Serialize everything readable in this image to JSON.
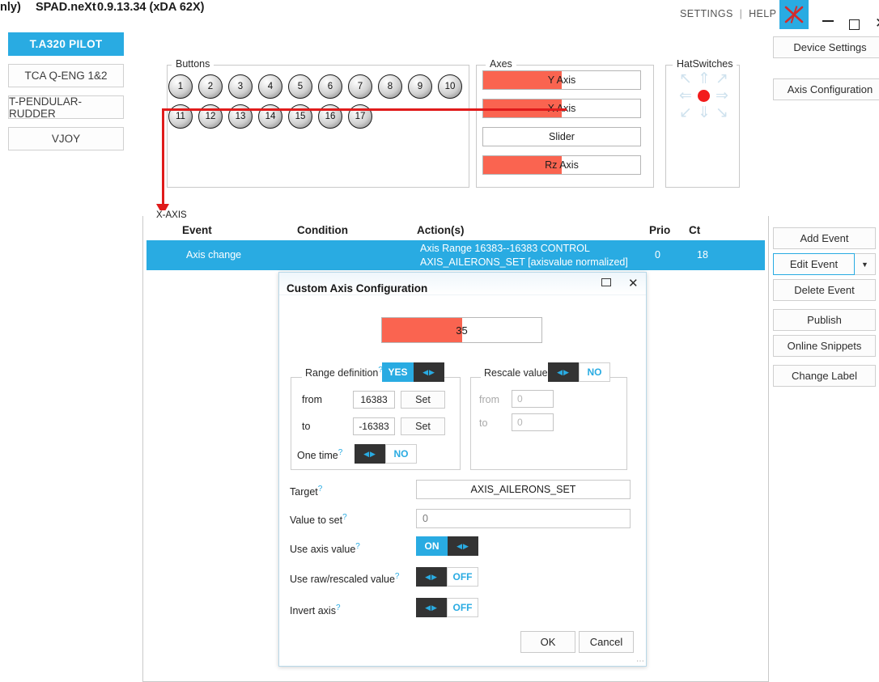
{
  "app": {
    "title_prefix": "nly)",
    "name": "SPAD.neXt",
    "version": "0.9.13.34 (xDA 62X)",
    "logo_icon": "red-plane-icon",
    "accent_color": "#29ABE2",
    "axis_fill_color": "#fa6450",
    "annotation_color": "#e01b1b"
  },
  "topmenu": {
    "settings": "SETTINGS",
    "separator": "|",
    "help": "HELP"
  },
  "window_controls": {
    "minimize": "minimize-icon",
    "maximize": "maximize-icon",
    "close": "close-icon"
  },
  "devices": [
    {
      "label": "T.A320 PILOT",
      "active": true
    },
    {
      "label": "TCA Q-ENG 1&2",
      "active": false
    },
    {
      "label": "T-PENDULAR-RUDDER",
      "active": false
    },
    {
      "label": "VJOY",
      "active": false
    }
  ],
  "right_panel": {
    "device_settings": "Device Settings",
    "axis_configuration": "Axis Configuration"
  },
  "buttons_group": {
    "label": "Buttons",
    "items": [
      "1",
      "2",
      "3",
      "4",
      "5",
      "6",
      "7",
      "8",
      "9",
      "10",
      "11",
      "12",
      "13",
      "14",
      "15",
      "16",
      "17"
    ]
  },
  "axes_group": {
    "label": "Axes",
    "items": [
      {
        "label": "Y Axis",
        "fill_percent": 50
      },
      {
        "label": "X Axis",
        "fill_percent": 50
      },
      {
        "label": "Slider",
        "fill_percent": 0
      },
      {
        "label": "Rz Axis",
        "fill_percent": 50
      }
    ]
  },
  "hat_group": {
    "label": "HatSwitches",
    "arrows": [
      "↖",
      "⇑",
      "↗",
      "⇐",
      "⇒",
      "↙",
      "⇓",
      "↘"
    ],
    "center_icon": "hat-center-dot"
  },
  "annotation": {
    "label": "X-AXIS"
  },
  "event_table": {
    "columns": [
      "Event",
      "Condition",
      "Action(s)",
      "Prio",
      "Ct"
    ],
    "rows": [
      {
        "event": "Axis change",
        "condition": "",
        "action_line1": "Axis Range 16383--16383 CONTROL",
        "action_line2": "AXIS_AILERONS_SET [axisvalue normalized]",
        "prio": "0",
        "ct": "18",
        "selected": true
      }
    ]
  },
  "event_actions": [
    {
      "label": "Add Event",
      "focused": false,
      "split": false
    },
    {
      "label": "Edit Event",
      "focused": true,
      "split": true
    },
    {
      "label": "Delete Event",
      "focused": false,
      "split": false
    },
    {
      "label": "Publish",
      "focused": false,
      "split": false
    },
    {
      "label": "Online Snippets",
      "focused": false,
      "split": false
    },
    {
      "label": "Change Label",
      "focused": false,
      "split": false
    }
  ],
  "dialog": {
    "title": "Custom Axis Configuration",
    "maximize_icon": "maximize-icon",
    "close_icon": "close-icon",
    "value_bar": {
      "value": "35",
      "fill_percent": 50
    },
    "range_definition": {
      "label": "Range definition",
      "help_marker": "?",
      "toggle": {
        "state": "YES",
        "on": true,
        "knob_icon": "arrows-lr-icon"
      },
      "from_label": "from",
      "from_value": "16383",
      "from_set": "Set",
      "to_label": "to",
      "to_value": "-16383",
      "to_set": "Set",
      "one_time_label": "One time",
      "one_time_toggle": {
        "state": "NO",
        "on": false,
        "knob_icon": "arrows-lr-icon"
      }
    },
    "rescale_value": {
      "label": "Rescale value",
      "help_marker": "?",
      "toggle": {
        "state": "NO",
        "on": false,
        "knob_icon": "arrows-lr-icon"
      },
      "from_label": "from",
      "from_value": "0",
      "to_label": "to",
      "to_value": "0"
    },
    "target": {
      "label": "Target",
      "help_marker": "?",
      "value": "AXIS_AILERONS_SET"
    },
    "value_to_set": {
      "label": "Value to set",
      "help_marker": "?",
      "value": "0"
    },
    "use_axis_value": {
      "label": "Use axis value",
      "help_marker": "?",
      "state": "ON",
      "on": true
    },
    "use_raw_rescaled": {
      "label": "Use raw/rescaled value",
      "help_marker": "?",
      "state": "OFF",
      "on": false
    },
    "invert_axis": {
      "label": "Invert axis",
      "help_marker": "?",
      "state": "OFF",
      "on": false
    },
    "ok": "OK",
    "cancel": "Cancel",
    "resize_grip": "resize-grip-icon"
  }
}
